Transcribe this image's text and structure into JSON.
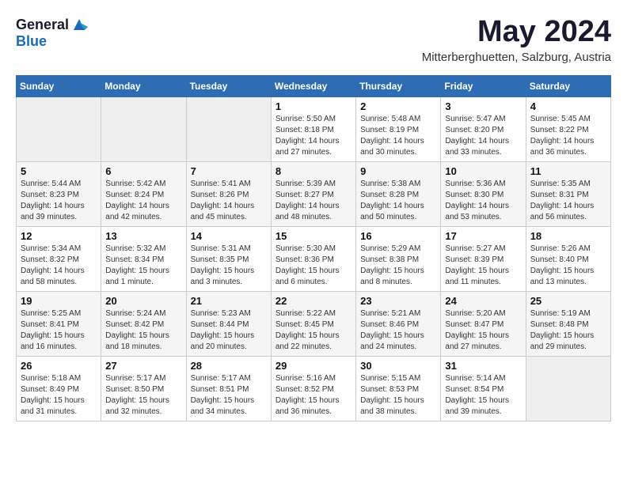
{
  "header": {
    "logo_general": "General",
    "logo_blue": "Blue",
    "title": "May 2024",
    "subtitle": "Mitterberghuetten, Salzburg, Austria"
  },
  "weekdays": [
    "Sunday",
    "Monday",
    "Tuesday",
    "Wednesday",
    "Thursday",
    "Friday",
    "Saturday"
  ],
  "weeks": [
    [
      {
        "day": "",
        "info": ""
      },
      {
        "day": "",
        "info": ""
      },
      {
        "day": "",
        "info": ""
      },
      {
        "day": "1",
        "info": "Sunrise: 5:50 AM\nSunset: 8:18 PM\nDaylight: 14 hours and 27 minutes."
      },
      {
        "day": "2",
        "info": "Sunrise: 5:48 AM\nSunset: 8:19 PM\nDaylight: 14 hours and 30 minutes."
      },
      {
        "day": "3",
        "info": "Sunrise: 5:47 AM\nSunset: 8:20 PM\nDaylight: 14 hours and 33 minutes."
      },
      {
        "day": "4",
        "info": "Sunrise: 5:45 AM\nSunset: 8:22 PM\nDaylight: 14 hours and 36 minutes."
      }
    ],
    [
      {
        "day": "5",
        "info": "Sunrise: 5:44 AM\nSunset: 8:23 PM\nDaylight: 14 hours and 39 minutes."
      },
      {
        "day": "6",
        "info": "Sunrise: 5:42 AM\nSunset: 8:24 PM\nDaylight: 14 hours and 42 minutes."
      },
      {
        "day": "7",
        "info": "Sunrise: 5:41 AM\nSunset: 8:26 PM\nDaylight: 14 hours and 45 minutes."
      },
      {
        "day": "8",
        "info": "Sunrise: 5:39 AM\nSunset: 8:27 PM\nDaylight: 14 hours and 48 minutes."
      },
      {
        "day": "9",
        "info": "Sunrise: 5:38 AM\nSunset: 8:28 PM\nDaylight: 14 hours and 50 minutes."
      },
      {
        "day": "10",
        "info": "Sunrise: 5:36 AM\nSunset: 8:30 PM\nDaylight: 14 hours and 53 minutes."
      },
      {
        "day": "11",
        "info": "Sunrise: 5:35 AM\nSunset: 8:31 PM\nDaylight: 14 hours and 56 minutes."
      }
    ],
    [
      {
        "day": "12",
        "info": "Sunrise: 5:34 AM\nSunset: 8:32 PM\nDaylight: 14 hours and 58 minutes."
      },
      {
        "day": "13",
        "info": "Sunrise: 5:32 AM\nSunset: 8:34 PM\nDaylight: 15 hours and 1 minute."
      },
      {
        "day": "14",
        "info": "Sunrise: 5:31 AM\nSunset: 8:35 PM\nDaylight: 15 hours and 3 minutes."
      },
      {
        "day": "15",
        "info": "Sunrise: 5:30 AM\nSunset: 8:36 PM\nDaylight: 15 hours and 6 minutes."
      },
      {
        "day": "16",
        "info": "Sunrise: 5:29 AM\nSunset: 8:38 PM\nDaylight: 15 hours and 8 minutes."
      },
      {
        "day": "17",
        "info": "Sunrise: 5:27 AM\nSunset: 8:39 PM\nDaylight: 15 hours and 11 minutes."
      },
      {
        "day": "18",
        "info": "Sunrise: 5:26 AM\nSunset: 8:40 PM\nDaylight: 15 hours and 13 minutes."
      }
    ],
    [
      {
        "day": "19",
        "info": "Sunrise: 5:25 AM\nSunset: 8:41 PM\nDaylight: 15 hours and 16 minutes."
      },
      {
        "day": "20",
        "info": "Sunrise: 5:24 AM\nSunset: 8:42 PM\nDaylight: 15 hours and 18 minutes."
      },
      {
        "day": "21",
        "info": "Sunrise: 5:23 AM\nSunset: 8:44 PM\nDaylight: 15 hours and 20 minutes."
      },
      {
        "day": "22",
        "info": "Sunrise: 5:22 AM\nSunset: 8:45 PM\nDaylight: 15 hours and 22 minutes."
      },
      {
        "day": "23",
        "info": "Sunrise: 5:21 AM\nSunset: 8:46 PM\nDaylight: 15 hours and 24 minutes."
      },
      {
        "day": "24",
        "info": "Sunrise: 5:20 AM\nSunset: 8:47 PM\nDaylight: 15 hours and 27 minutes."
      },
      {
        "day": "25",
        "info": "Sunrise: 5:19 AM\nSunset: 8:48 PM\nDaylight: 15 hours and 29 minutes."
      }
    ],
    [
      {
        "day": "26",
        "info": "Sunrise: 5:18 AM\nSunset: 8:49 PM\nDaylight: 15 hours and 31 minutes."
      },
      {
        "day": "27",
        "info": "Sunrise: 5:17 AM\nSunset: 8:50 PM\nDaylight: 15 hours and 32 minutes."
      },
      {
        "day": "28",
        "info": "Sunrise: 5:17 AM\nSunset: 8:51 PM\nDaylight: 15 hours and 34 minutes."
      },
      {
        "day": "29",
        "info": "Sunrise: 5:16 AM\nSunset: 8:52 PM\nDaylight: 15 hours and 36 minutes."
      },
      {
        "day": "30",
        "info": "Sunrise: 5:15 AM\nSunset: 8:53 PM\nDaylight: 15 hours and 38 minutes."
      },
      {
        "day": "31",
        "info": "Sunrise: 5:14 AM\nSunset: 8:54 PM\nDaylight: 15 hours and 39 minutes."
      },
      {
        "day": "",
        "info": ""
      }
    ]
  ]
}
